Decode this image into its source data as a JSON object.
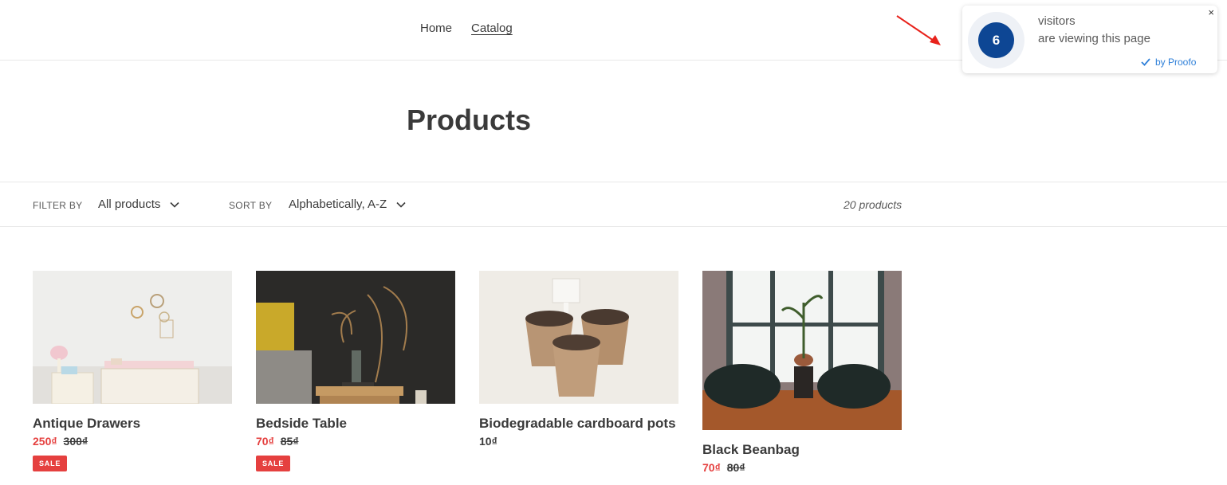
{
  "nav": {
    "home": "Home",
    "catalog": "Catalog"
  },
  "popup": {
    "count": "6",
    "line1": "visitors",
    "line2": "are viewing this page",
    "by": "by Proofo",
    "close": "×"
  },
  "page": {
    "title": "Products"
  },
  "filters": {
    "filter_label": "FILTER BY",
    "filter_value": "All products",
    "sort_label": "SORT BY",
    "sort_value": "Alphabetically, A-Z",
    "count": "20 products"
  },
  "products": [
    {
      "name": "Antique Drawers",
      "price": "250₫",
      "compare": "300₫",
      "badge": "SALE"
    },
    {
      "name": "Bedside Table",
      "price": "70₫",
      "compare": "85₫",
      "badge": "SALE"
    },
    {
      "name": "Biodegradable cardboard pots",
      "price": "10₫"
    },
    {
      "name": "Black Beanbag",
      "price": "70₫",
      "compare": "80₫"
    }
  ],
  "colors": {
    "accent_red": "#e5403f",
    "popup_blue": "#0d4694",
    "link_blue": "#2f80d9"
  }
}
